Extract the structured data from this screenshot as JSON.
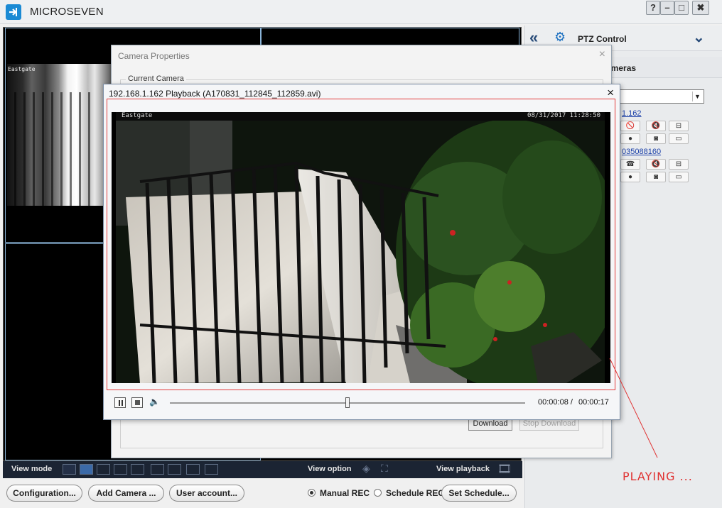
{
  "app": {
    "title": "MICROSEVEN"
  },
  "window_controls": {
    "help": "?",
    "minimize": "–",
    "maximize": "□",
    "close": "✖"
  },
  "video_grid": {
    "cell1_label": "Eastgate"
  },
  "right_panel": {
    "ptz_title": "PTZ Control",
    "cameras_title": "ameras",
    "camera1_link": "1.162",
    "camera2_link": "035088160"
  },
  "camera_properties": {
    "title": "Camera Properties",
    "close": "×",
    "group_label": "Current Camera",
    "download_label": "Download",
    "stop_download_label": "Stop Download"
  },
  "playback": {
    "title": "192.168.1.162 Playback (A170831_112845_112859.avi)",
    "close": "×",
    "video_label": "Eastgate",
    "video_timestamp": "08/31/2017 11:28:50",
    "time_current": "00:00:08 /",
    "time_total": "00:00:17",
    "progress_fraction": 0.5
  },
  "viewmode_bar": {
    "view_mode": "View mode",
    "view_option": "View option",
    "view_playback": "View playback"
  },
  "bottom_bar": {
    "configuration": "Configuration...",
    "add_camera": "Add Camera ...",
    "user_account": "User account...",
    "manual_rec": "Manual REC",
    "schedule_rec": "Schedule REC",
    "set_schedule": "Set Schedule..."
  },
  "annotation": {
    "text": "PLAYING ..."
  },
  "colors": {
    "accent": "#1a8ad4",
    "annotation": "#e03232",
    "dark_bar": "#1b2433"
  }
}
